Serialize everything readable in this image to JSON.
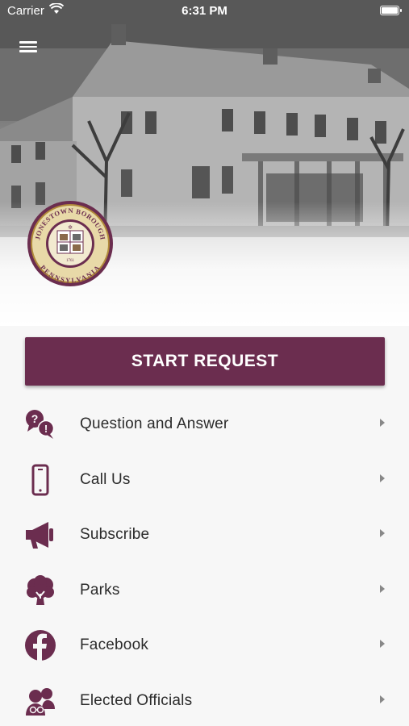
{
  "status_bar": {
    "carrier": "Carrier",
    "time": "6:31 PM",
    "battery_level": 1.0
  },
  "colors": {
    "brand": "#6b2d4f",
    "text": "#2b2b2b",
    "chevron": "#888888"
  },
  "seal": {
    "top_text": "JONESTOWN BOROUGH",
    "bottom_text": "PENNSYLVANIA",
    "year": "1761"
  },
  "start_button": {
    "label": "START REQUEST"
  },
  "menu": [
    {
      "label": "Question and Answer",
      "icon": "question-answer-icon"
    },
    {
      "label": "Call Us",
      "icon": "phone-icon"
    },
    {
      "label": "Subscribe",
      "icon": "megaphone-icon"
    },
    {
      "label": "Parks",
      "icon": "tree-icon"
    },
    {
      "label": "Facebook",
      "icon": "facebook-icon"
    },
    {
      "label": "Elected Officials",
      "icon": "officials-icon"
    }
  ]
}
